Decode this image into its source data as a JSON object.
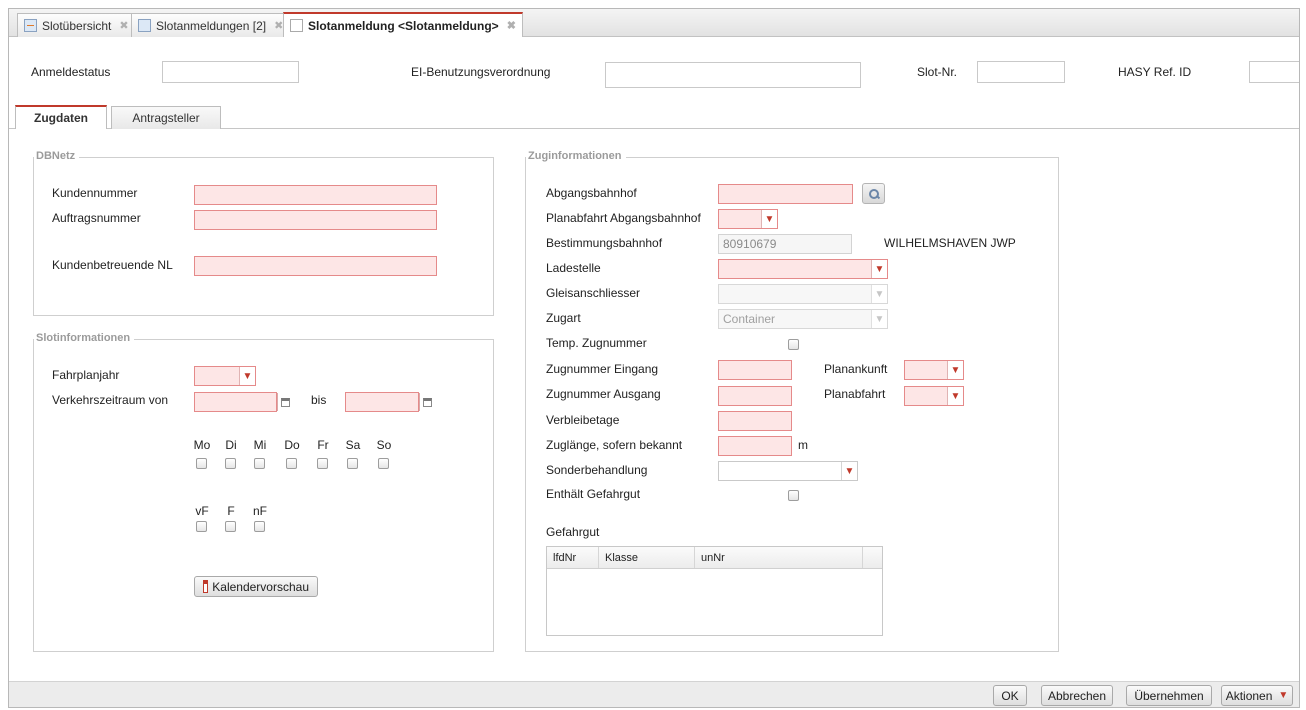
{
  "tabs": [
    {
      "label": "Slotübersicht",
      "icon": "grid-icon"
    },
    {
      "label": "Slotanmeldungen [2]",
      "icon": "documents-icon"
    },
    {
      "label": "Slotanmeldung <Slotanmeldung>",
      "icon": "document-icon",
      "active": true
    }
  ],
  "header": {
    "anmeldestatus_label": "Anmeldestatus",
    "anmeldestatus_value": "",
    "ei_label": "EI-Benutzungsverordnung",
    "ei_value": "",
    "slotnr_label": "Slot-Nr.",
    "slotnr_value": "",
    "hasy_label": "HASY Ref. ID",
    "hasy_value": ""
  },
  "form_tabs": [
    {
      "label": "Zugdaten",
      "active": true
    },
    {
      "label": "Antragsteller",
      "active": false
    }
  ],
  "dbnetz": {
    "legend": "DBNetz",
    "kundennummer_label": "Kundennummer",
    "auftragsnummer_label": "Auftragsnummer",
    "kundenbetreuende_label": "Kundenbetreuende NL"
  },
  "slot": {
    "legend": "Slotinformationen",
    "fahrplanjahr_label": "Fahrplanjahr",
    "verkehrszeitraum_label": "Verkehrszeitraum von",
    "bis_label": "bis",
    "days": [
      "Mo",
      "Di",
      "Mi",
      "Do",
      "Fr",
      "Sa",
      "So"
    ],
    "feiertage": [
      "vF",
      "F",
      "nF"
    ],
    "kalender_button": "Kalendervorschau"
  },
  "zug": {
    "legend": "Zuginformationen",
    "abgangsbahnhof_label": "Abgangsbahnhof",
    "planabfahrt_abgang_label": "Planabfahrt Abgangsbahnhof",
    "bestimmungsbahnhof_label": "Bestimmungsbahnhof",
    "bestimmungsbahnhof_value": "80910679",
    "bestimmungsbahnhof_name": "WILHELMSHAVEN JWP",
    "ladestelle_label": "Ladestelle",
    "gleisanschliesser_label": "Gleisanschliesser",
    "zugart_label": "Zugart",
    "zugart_value": "Container",
    "temp_zugnummer_label": "Temp. Zugnummer",
    "zugnummer_eingang_label": "Zugnummer Eingang",
    "planankunft_label": "Planankunft",
    "zugnummer_ausgang_label": "Zugnummer Ausgang",
    "planabfahrt_label": "Planabfahrt",
    "verbleibetage_label": "Verbleibetage",
    "zuglaenge_label": "Zuglänge, sofern bekannt",
    "zuglaenge_unit": "m",
    "sonderbehandlung_label": "Sonderbehandlung",
    "gefahrgut_enthaelt_label": "Enthält Gefahrgut",
    "gefahrgut_label": "Gefahrgut",
    "gefahrgut_columns": [
      "lfdNr",
      "Klasse",
      "unNr"
    ]
  },
  "footer": {
    "ok": "OK",
    "abbrechen": "Abbrechen",
    "uebernehmen": "Übernehmen",
    "aktionen": "Aktionen"
  },
  "colors": {
    "required_bg": "#fde6e6",
    "required_border": "#e58a8a",
    "accent": "#c0392b"
  }
}
